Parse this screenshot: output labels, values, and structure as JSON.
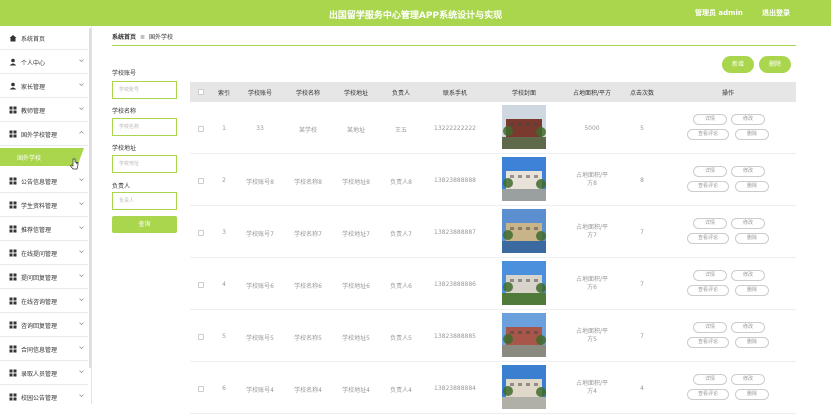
{
  "header": {
    "title": "出国留学服务中心管理APP系统设计与实现",
    "user_label": "管理员 admin",
    "logout_label": "退出登录"
  },
  "sidebar": {
    "items": [
      {
        "label": "系统首页",
        "icon": "home-icon"
      },
      {
        "label": "个人中心",
        "icon": "person-icon"
      },
      {
        "label": "家长管理",
        "icon": "person-icon"
      },
      {
        "label": "教师管理",
        "icon": "grid-icon"
      },
      {
        "label": "国外学校管理",
        "icon": "grid-icon"
      },
      {
        "label": "公告信息管理",
        "icon": "grid-icon"
      },
      {
        "label": "学生资料管理",
        "icon": "grid-icon"
      },
      {
        "label": "推荐信管理",
        "icon": "grid-icon"
      },
      {
        "label": "在线提问管理",
        "icon": "grid-icon"
      },
      {
        "label": "提问回复管理",
        "icon": "grid-icon"
      },
      {
        "label": "在线咨询管理",
        "icon": "grid-icon"
      },
      {
        "label": "咨询回复管理",
        "icon": "grid-icon"
      },
      {
        "label": "合同信息管理",
        "icon": "grid-icon"
      },
      {
        "label": "录取人员管理",
        "icon": "grid-icon"
      },
      {
        "label": "校园公告管理",
        "icon": "grid-icon"
      }
    ],
    "active_sub": "国外学校"
  },
  "breadcrumb": {
    "home": "系统首页",
    "sep": "≣",
    "current": "国外学校"
  },
  "actions": {
    "add_label": "新增",
    "delete_label": "删除"
  },
  "search": {
    "f1_label": "学校账号",
    "f1_placeholder": "学校账号",
    "f2_label": "学校名称",
    "f2_placeholder": "学校名称",
    "f3_label": "学校地址",
    "f3_placeholder": "学校地址",
    "f4_label": "负责人",
    "f4_placeholder": "负责人",
    "button_label": "查询"
  },
  "table": {
    "headers": [
      "索引",
      "学校账号",
      "学校名称",
      "学校地址",
      "负责人",
      "联系手机",
      "学校封面",
      "占地面积/平方",
      "点击次数",
      "操作"
    ],
    "op_labels": {
      "detail": "详情",
      "edit": "修改",
      "review": "查看评论",
      "delete": "删除"
    },
    "rows": [
      {
        "index": "1",
        "account": "33",
        "name": "某学校",
        "address": "某地址",
        "person": "王五",
        "phone": "13222222222",
        "area": "5000",
        "clicks": "5",
        "cover": "cover-1"
      },
      {
        "index": "2",
        "account": "学校账号8",
        "name": "学校名称8",
        "address": "学校地址8",
        "person": "负责人8",
        "phone": "13823888888",
        "area": "占地面积/平方8",
        "clicks": "8",
        "cover": "cover-2"
      },
      {
        "index": "3",
        "account": "学校账号7",
        "name": "学校名称7",
        "address": "学校地址7",
        "person": "负责人7",
        "phone": "13823888887",
        "area": "占地面积/平方7",
        "clicks": "7",
        "cover": "cover-3"
      },
      {
        "index": "4",
        "account": "学校账号6",
        "name": "学校名称6",
        "address": "学校地址6",
        "person": "负责人6",
        "phone": "13823888886",
        "area": "占地面积/平方6",
        "clicks": "7",
        "cover": "cover-4"
      },
      {
        "index": "5",
        "account": "学校账号5",
        "name": "学校名称5",
        "address": "学校地址5",
        "person": "负责人5",
        "phone": "13823888885",
        "area": "占地面积/平方5",
        "clicks": "7",
        "cover": "cover-5"
      },
      {
        "index": "6",
        "account": "学校账号4",
        "name": "学校名称4",
        "address": "学校地址4",
        "person": "负责人4",
        "phone": "13823888884",
        "area": "占地面积/平方4",
        "clicks": "4",
        "cover": "cover-6"
      }
    ]
  },
  "colors": {
    "accent": "#a9d64c"
  }
}
